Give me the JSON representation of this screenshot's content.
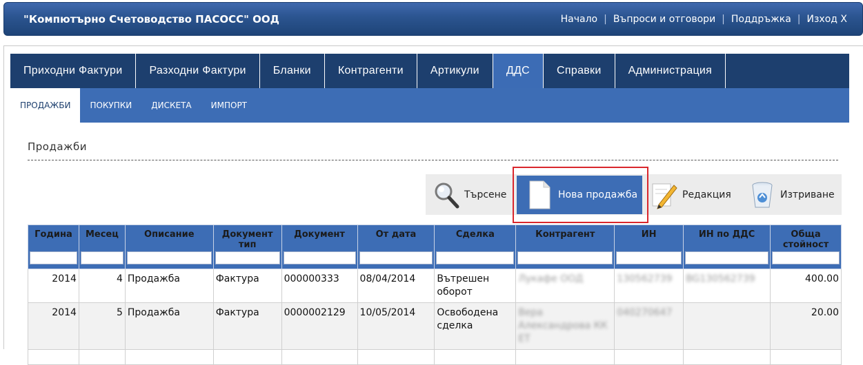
{
  "header": {
    "company": "\"Компютърно Счетоводство ПАСОСС\" ООД",
    "links": [
      "Начало",
      "Въпроси и отговори",
      "Поддръжка",
      "Изход X"
    ]
  },
  "mainnav": {
    "tabs": [
      "Приходни Фактури",
      "Разходни Фактури",
      "Бланки",
      "Контрагенти",
      "Артикули",
      "ДДС",
      "Справки",
      "Администрация"
    ],
    "active": "ДДС"
  },
  "subnav": {
    "tabs": [
      "ПРОДАЖБИ",
      "ПОКУПКИ",
      "ДИСКЕТА",
      "ИМПОРТ"
    ],
    "active": "ПРОДАЖБИ"
  },
  "page": {
    "title": "Продажби"
  },
  "toolbar": {
    "search_label": "Търсене",
    "new_label": "Нова продажба",
    "edit_label": "Редакция",
    "delete_label": "Изтриване"
  },
  "table": {
    "columns": [
      "Година",
      "Месец",
      "Описание",
      "Документ тип",
      "Документ",
      "От дата",
      "Сделка",
      "Контрагент",
      "ИН",
      "ИН по ДДС",
      "Обща стойност"
    ],
    "rows": [
      [
        "2014",
        "4",
        "Продажба",
        "Фактура",
        "000000333",
        "08/04/2014",
        "Вътрешен оборот",
        "Лукафе ООД",
        "130562739",
        "BG130562739",
        "400.00"
      ],
      [
        "2014",
        "5",
        "Продажба",
        "Фактура",
        "0000002129",
        "10/05/2014",
        "Освободена сделка",
        "Вера Александрова КК ЕТ",
        "040270647",
        "",
        "20.00"
      ]
    ]
  },
  "colors": {
    "header": "#2b548f",
    "nav": "#1d3f6e",
    "accent": "#3d6db5",
    "highlight": "#d9262c"
  }
}
